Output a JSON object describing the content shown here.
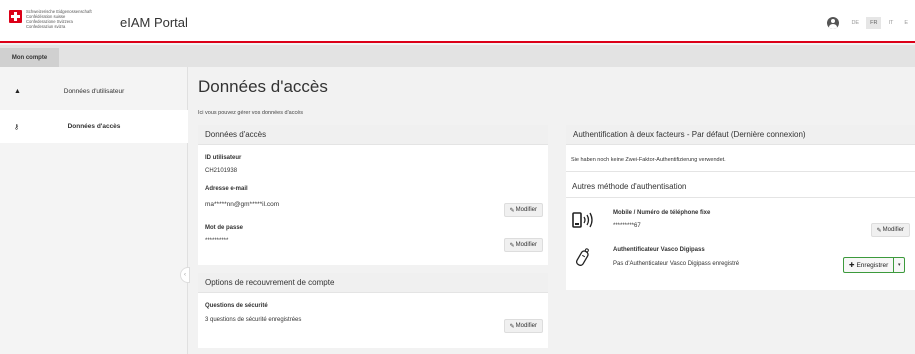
{
  "header": {
    "confederation_lines": [
      "Schweizerische Eidgenossenschaft",
      "Confédération suisse",
      "Confederazione Svizzera",
      "Confederaziun svizra"
    ],
    "portal_title": "eIAM Portal",
    "languages": [
      {
        "code": "DE",
        "active": false
      },
      {
        "code": "FR",
        "active": true
      },
      {
        "code": "IT",
        "active": false
      },
      {
        "code": "E",
        "active": false
      }
    ]
  },
  "tabs": {
    "account": "Mon compte"
  },
  "sidebar": {
    "items": [
      {
        "label": "Données d'utilisateur",
        "icon": "user-icon",
        "active": false
      },
      {
        "label": "Données d'accès",
        "icon": "key-icon",
        "active": true
      }
    ],
    "collapse_glyph": "‹"
  },
  "main": {
    "title": "Données d'accès",
    "subtitle": "Ici vous pouvez gérer vos données d'accès"
  },
  "access_card": {
    "title": "Données d'accès",
    "user_id_label": "ID utilisateur",
    "user_id_value": "CH2101938",
    "email_label": "Adresse e-mail",
    "email_value": "ma*****nn@gm*****il.com",
    "password_label": "Mot de passe",
    "password_value": "**********",
    "modify_label": "Modifier"
  },
  "recovery_card": {
    "title": "Options de recouvrement de compte",
    "questions_label": "Questions de sécurité",
    "questions_value": "3 questions de sécurité enregistrées",
    "modify_label": "Modifier"
  },
  "twofa_card": {
    "title": "Authentification à deux facteurs - Par défaut (Dernière connexion)",
    "note": "Sie haben noch keine Zwei-Faktor-Authentifizierung verwendet.",
    "other_methods_title": "Autres méthode d'authentisation",
    "mobile_label": "Mobile / Numéro de téléphone fixe",
    "mobile_value": "*********67",
    "modify_label": "Modifier",
    "vasco_label": "Authentificateur Vasco Digipass",
    "vasco_value": "Pas d'Authenticateur Vasco Digipass enregistré",
    "register_label": "Enregistrer"
  },
  "icons": {
    "pencil": "✎",
    "plus": "✚",
    "caret": "▾",
    "user": "▲",
    "key": "⚷"
  }
}
